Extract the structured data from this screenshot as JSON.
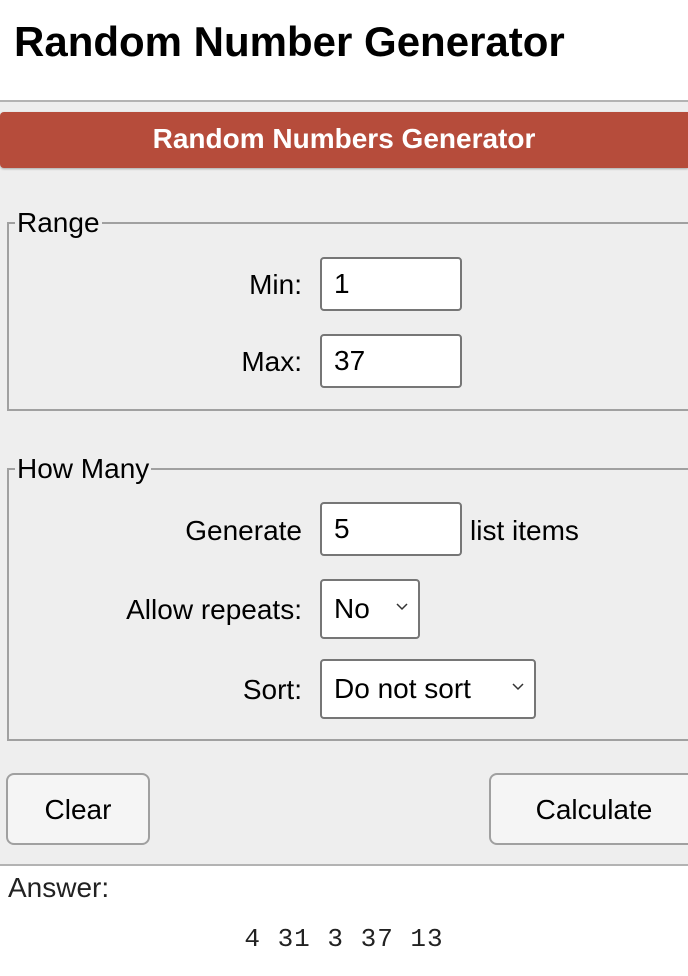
{
  "page": {
    "title": "Random Number Generator"
  },
  "panel": {
    "header": "Random Numbers Generator",
    "header_color": "#b64c3b",
    "range": {
      "legend": "Range",
      "min_label": "Min:",
      "min_value": "1",
      "max_label": "Max:",
      "max_value": "37"
    },
    "how_many": {
      "legend": "How Many",
      "generate_label": "Generate",
      "generate_value": "5",
      "generate_suffix": "list items",
      "repeats_label": "Allow repeats:",
      "repeats_value": "No",
      "sort_label": "Sort:",
      "sort_value": "Do not sort"
    },
    "buttons": {
      "clear": "Clear",
      "calculate": "Calculate"
    }
  },
  "answer": {
    "label": "Answer:",
    "value": "4 31 3 37 13"
  }
}
